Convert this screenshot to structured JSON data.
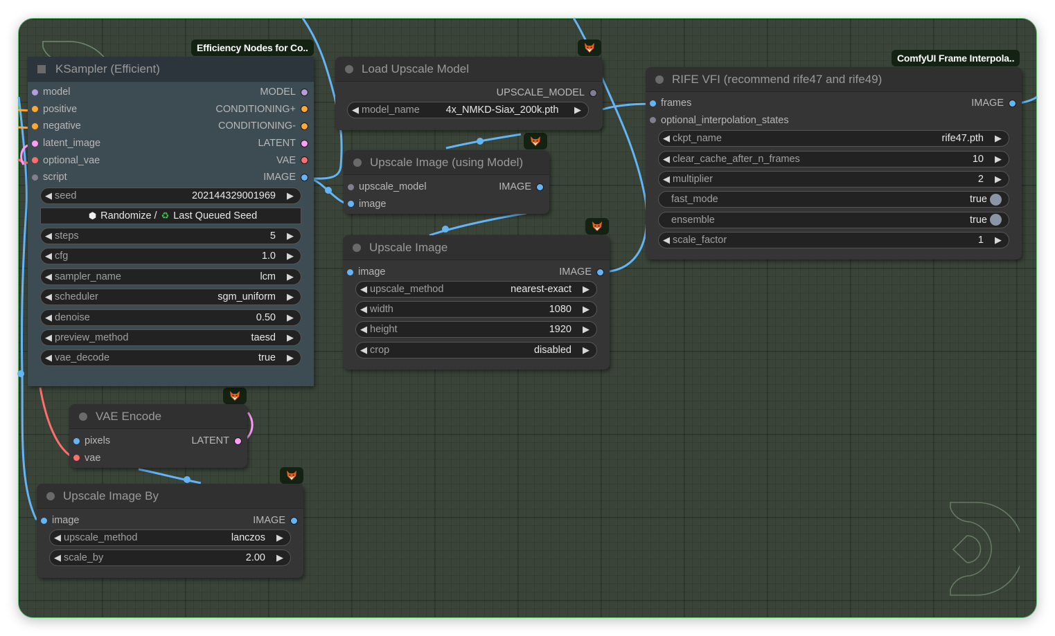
{
  "colors": {
    "canvas_bg": "#3a4439",
    "link_image": "#64b5f6",
    "link_vae": "#ff6e6e",
    "link_latent": "#ff9cf9",
    "link_conditioning": "#ffa931",
    "slot_model": "#b39ddb",
    "slot_conditioning": "#ffa931",
    "slot_latent": "#ff9cf9",
    "slot_vae": "#ff6e6e",
    "slot_image": "#64b5f6",
    "slot_generic": "#7f7f8f"
  },
  "badges": {
    "efficiency": "Efficiency Nodes for Co..",
    "frame_interp": "ComfyUI Frame Interpola.."
  },
  "nodes": {
    "ksampler": {
      "title": "KSampler (Efficient)",
      "inputs": [
        "model",
        "positive",
        "negative",
        "latent_image",
        "optional_vae",
        "script"
      ],
      "outputs": [
        "MODEL",
        "CONDITIONING+",
        "CONDITIONING-",
        "LATENT",
        "VAE",
        "IMAGE"
      ],
      "seed": {
        "label": "seed",
        "value": "202144329001969"
      },
      "seed_button": {
        "randomize": "Randomize /",
        "last": "Last Queued Seed"
      },
      "widgets": [
        {
          "label": "steps",
          "value": "5"
        },
        {
          "label": "cfg",
          "value": "1.0"
        },
        {
          "label": "sampler_name",
          "value": "lcm"
        },
        {
          "label": "scheduler",
          "value": "sgm_uniform"
        },
        {
          "label": "denoise",
          "value": "0.50"
        },
        {
          "label": "preview_method",
          "value": "taesd"
        },
        {
          "label": "vae_decode",
          "value": "true"
        }
      ]
    },
    "load_upscale": {
      "title": "Load Upscale Model",
      "output": "UPSCALE_MODEL",
      "widget": {
        "label": "model_name",
        "value": "4x_NMKD-Siax_200k.pth"
      }
    },
    "upscale_model": {
      "title": "Upscale Image (using Model)",
      "inputs": [
        "upscale_model",
        "image"
      ],
      "output": "IMAGE"
    },
    "upscale_image": {
      "title": "Upscale Image",
      "input": "image",
      "output": "IMAGE",
      "widgets": [
        {
          "label": "upscale_method",
          "value": "nearest-exact"
        },
        {
          "label": "width",
          "value": "1080"
        },
        {
          "label": "height",
          "value": "1920"
        },
        {
          "label": "crop",
          "value": "disabled"
        }
      ]
    },
    "rife": {
      "title": "RIFE VFI (recommend rife47 and rife49)",
      "inputs": [
        "frames",
        "optional_interpolation_states"
      ],
      "output": "IMAGE",
      "widgets": [
        {
          "label": "ckpt_name",
          "value": "rife47.pth",
          "type": "combo"
        },
        {
          "label": "clear_cache_after_n_frames",
          "value": "10",
          "type": "number"
        },
        {
          "label": "multiplier",
          "value": "2",
          "type": "number"
        },
        {
          "label": "fast_mode",
          "value": "true",
          "type": "toggle"
        },
        {
          "label": "ensemble",
          "value": "true",
          "type": "toggle"
        },
        {
          "label": "scale_factor",
          "value": "1",
          "type": "number"
        }
      ]
    },
    "vae_encode": {
      "title": "VAE Encode",
      "inputs": [
        "pixels",
        "vae"
      ],
      "output": "LATENT"
    },
    "upscale_by": {
      "title": "Upscale Image By",
      "input": "image",
      "output": "IMAGE",
      "widgets": [
        {
          "label": "upscale_method",
          "value": "lanczos"
        },
        {
          "label": "scale_by",
          "value": "2.00"
        }
      ]
    }
  }
}
